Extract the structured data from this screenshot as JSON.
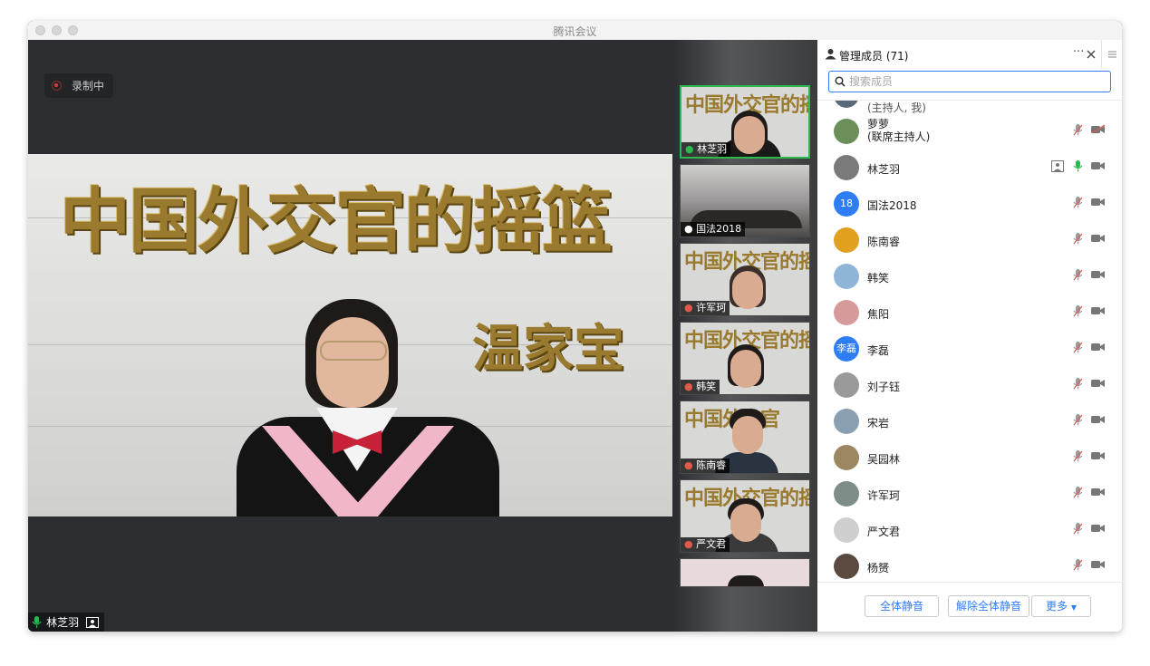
{
  "window": {
    "title": "腾讯会议"
  },
  "stage": {
    "recording_label": "录制中",
    "speaker_name": "林芝羽",
    "calligraphy_main": "中国外交官的摇篮",
    "calligraphy_sig": "温家宝"
  },
  "gallery": {
    "tiles": [
      {
        "name": "林芝羽",
        "mic": "on",
        "active": true
      },
      {
        "name": "国法2018",
        "mic": "muted-white"
      },
      {
        "name": "许军珂",
        "mic": "muted"
      },
      {
        "name": "韩笑",
        "mic": "muted"
      },
      {
        "name": "陈南睿",
        "mic": "muted"
      },
      {
        "name": "严文君",
        "mic": "muted"
      }
    ]
  },
  "panel": {
    "title": "管理成员 (71)",
    "more_label": "···",
    "search_placeholder": "搜索成员",
    "partial_row": "(主持人, 我)",
    "members": [
      {
        "name": "萝萝",
        "role": "(联席主持人)",
        "mic": "muted",
        "camera": "off",
        "avatar_color": "#6b8f5a"
      },
      {
        "name": "林芝羽",
        "mic": "on",
        "camera": "on",
        "sharing": true,
        "avatar_color": "#7a7a7a"
      },
      {
        "name": "国法2018",
        "mic": "muted-gray",
        "camera": "on",
        "avatar_text": "18",
        "avatar_color": "#2f7df6"
      },
      {
        "name": "陈南睿",
        "mic": "muted",
        "camera": "on",
        "avatar_color": "#e0a020"
      },
      {
        "name": "韩笑",
        "mic": "muted",
        "camera": "on",
        "avatar_color": "#8fb5d8"
      },
      {
        "name": "焦阳",
        "mic": "muted",
        "camera": "on",
        "avatar_color": "#d79a9a"
      },
      {
        "name": "李磊",
        "mic": "muted",
        "camera": "on",
        "avatar_text": "李磊",
        "avatar_color": "#2f7df6"
      },
      {
        "name": "刘子钰",
        "mic": "muted",
        "camera": "on",
        "avatar_color": "#9a9a9a"
      },
      {
        "name": "宋岩",
        "mic": "muted",
        "camera": "on",
        "avatar_color": "#8aa0b0"
      },
      {
        "name": "吴园林",
        "mic": "muted",
        "camera": "on",
        "avatar_color": "#9b8760"
      },
      {
        "name": "许军珂",
        "mic": "muted",
        "camera": "on",
        "avatar_color": "#7e8d88"
      },
      {
        "name": "严文君",
        "mic": "muted",
        "camera": "on",
        "avatar_color": "#cfcfcf"
      },
      {
        "name": "杨赟",
        "mic": "muted",
        "camera": "on",
        "avatar_color": "#5a4a40"
      }
    ],
    "footer": {
      "mute_all": "全体静音",
      "unmute_all": "解除全体静音",
      "more": "更多"
    }
  },
  "colors": {
    "accent": "#2f7df6",
    "mic_on": "#2db84d",
    "muted": "#e05a4b"
  }
}
